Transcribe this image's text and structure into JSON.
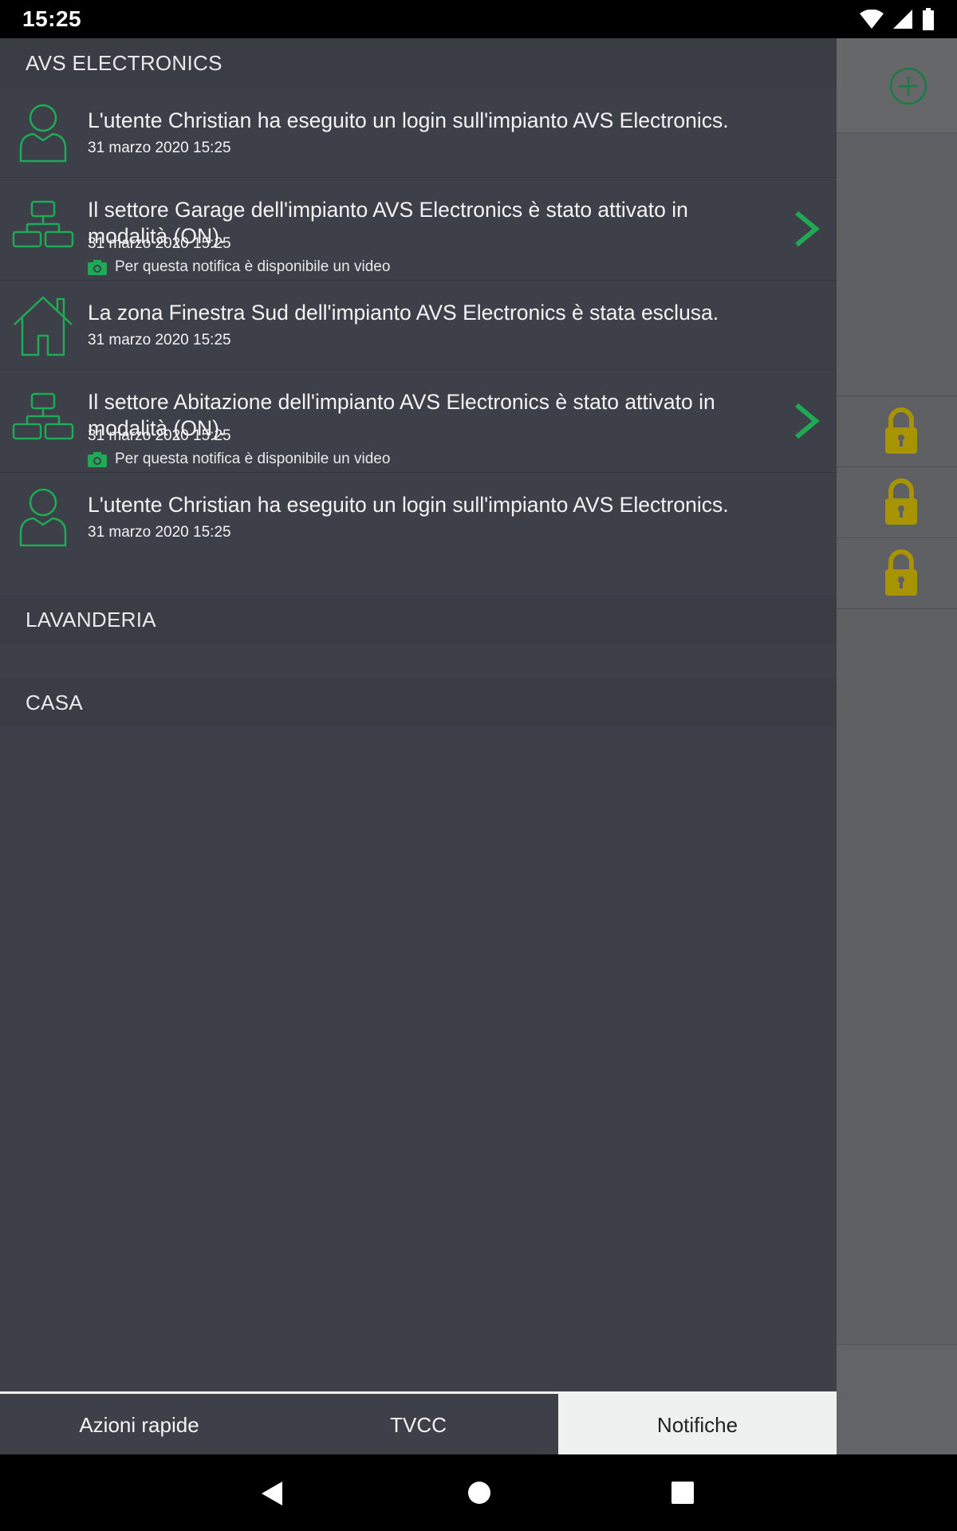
{
  "status_bar": {
    "time": "15:25"
  },
  "sections": [
    {
      "title": "AVS ELECTRONICS",
      "items": [
        {
          "icon": "user-icon",
          "title": "L'utente Christian ha eseguito un login sull'impianto AVS Electronics.",
          "date": "31 marzo 2020 15:25"
        },
        {
          "icon": "sector-icon",
          "title": "Il settore Garage dell'impianto AVS Electronics è stato attivato in modalità (ON).",
          "date": "31 marzo 2020 15:25",
          "video_note": "Per questa notifica è disponibile un video"
        },
        {
          "icon": "house-icon",
          "title": "La zona Finestra Sud dell'impianto AVS Electronics è stata esclusa.",
          "date": "31 marzo 2020 15:25"
        },
        {
          "icon": "sector-icon",
          "title": "Il settore Abitazione dell'impianto AVS Electronics è stato attivato in modalità (ON).",
          "date": "31 marzo 2020 15:25",
          "video_note": "Per questa notifica è disponibile un video"
        },
        {
          "icon": "user-icon",
          "title": "L'utente Christian ha eseguito un login sull'impianto AVS Electronics.",
          "date": "31 marzo 2020 15:25"
        }
      ]
    },
    {
      "title": "LAVANDERIA",
      "items": []
    },
    {
      "title": "CASA",
      "items": []
    }
  ],
  "tabs": [
    {
      "label": "Azioni rapide",
      "active": false
    },
    {
      "label": "TVCC",
      "active": false
    },
    {
      "label": "Notifiche",
      "active": true
    }
  ],
  "colors": {
    "accent_green": "#1faa55",
    "lock_yellow": "#a89400",
    "drawer_bg": "#3d4048"
  }
}
